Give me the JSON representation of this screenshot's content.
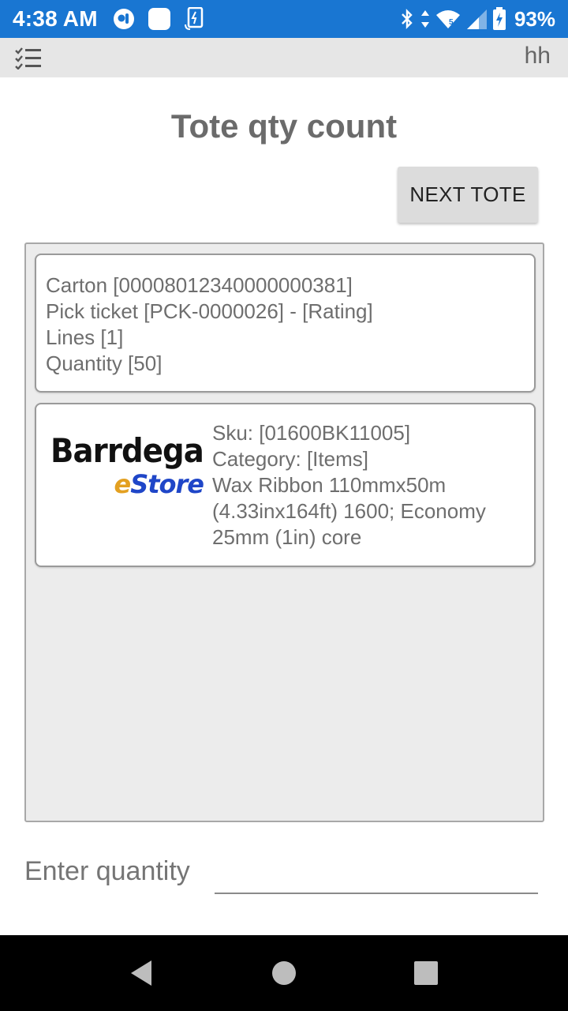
{
  "status_bar": {
    "time": "4:38 AM",
    "battery_percent": "93%",
    "signal_label": "5",
    "icons": [
      "notification-app-icon",
      "notification-square-icon",
      "phone-data-icon",
      "bluetooth-icon",
      "data-arrows-icon",
      "wifi-icon",
      "cell-signal-icon",
      "battery-charging-icon"
    ]
  },
  "app_bar": {
    "menu_icon": "checklist-icon",
    "user": "hh"
  },
  "page": {
    "title": "Tote qty count",
    "next_button_label": "NEXT TOTE"
  },
  "summary_card": {
    "carton": "Carton [00008012340000000381]",
    "pick_ticket": "Pick ticket [PCK-0000026] - [Rating]",
    "lines": "Lines [1]",
    "quantity": "Quantity [50]"
  },
  "item_card": {
    "logo": {
      "brand": "Barrdega",
      "store_e": "e",
      "store_rest": "Store"
    },
    "sku": "Sku: [01600BK11005]",
    "category": "Category: [Items]",
    "description": "Wax Ribbon 110mmx50m (4.33inx164ft) 1600; Economy 25mm (1in) core"
  },
  "quantity_entry": {
    "label": "Enter quantity",
    "value": ""
  },
  "nav_bar": {
    "icons": [
      "back-icon",
      "home-icon",
      "recents-icon"
    ]
  },
  "colors": {
    "status_bar": "#1976d2",
    "app_bar": "#e6e6e6",
    "button": "#dcdcdc",
    "panel": "#ececec"
  }
}
